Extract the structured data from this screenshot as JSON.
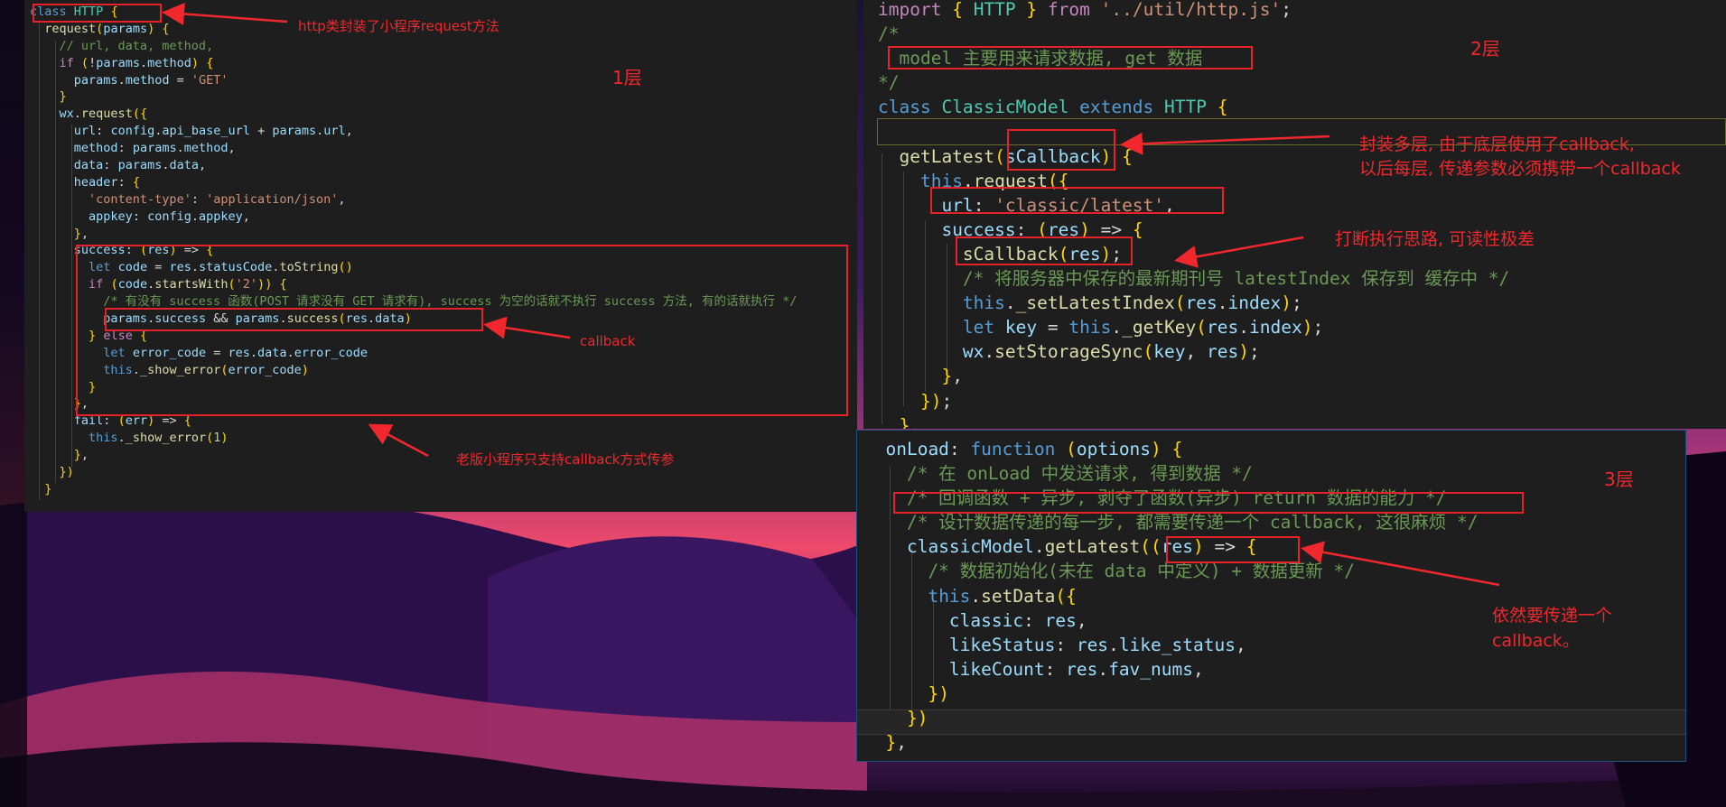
{
  "panel1": {
    "layer_label": "1层",
    "lines": [
      "class HTTP {",
      "  request(params) {",
      "    // url, data, method,",
      "    if (!params.method) {",
      "      params.method = 'GET'",
      "    }",
      "    wx.request({",
      "      url: config.api_base_url + params.url,",
      "      method: params.method,",
      "      data: params.data,",
      "      header: {",
      "        'content-type': 'application/json',",
      "        appkey: config.appkey,",
      "      },",
      "      success: (res) => {",
      "        let code = res.statusCode.toString()",
      "        if (code.startsWith('2')) {",
      "          /* 有没有 success 函数(POST 请求没有 GET 请求有), success 为空的话就不执行 success 方法, 有的话就执行 */",
      "          params.success && params.success(res.data)",
      "        } else {",
      "          let error_code = res.data.error_code",
      "          this._show_error(error_code)",
      "        }",
      "      },",
      "      fail: (err) => {",
      "        this._show_error(1)",
      "      },",
      "    })",
      "  }"
    ],
    "annotations": {
      "class_note": "http类封装了小程序request方法",
      "callback_note": "callback",
      "old_note": "老版小程序只支持callback方式传参"
    }
  },
  "panel2": {
    "layer_label": "2层",
    "lines": [
      "import { HTTP } from '../util/http.js';",
      "/*",
      "  model 主要用来请求数据, get 数据",
      "*/",
      "class ClassicModel extends HTTP {",
      "",
      "  getLatest(sCallback) {",
      "    this.request({",
      "      url: 'classic/latest',",
      "      success: (res) => {",
      "        sCallback(res);",
      "        /* 将服务器中保存的最新期刊号 latestIndex 保存到 缓存中 */",
      "        this._setLatestIndex(res.index);",
      "        let key = this._getKey(res.index);",
      "        wx.setStorageSync(key, res);",
      "      },",
      "    });",
      "  },"
    ],
    "annotations": {
      "wrap_note_1": "封装多层, 由于底层使用了callback,",
      "wrap_note_2": "以后每层, 传递参数必须携带一个callback",
      "break_note": "打断执行思路, 可读性极差"
    }
  },
  "panel3": {
    "layer_label": "3层",
    "lines": [
      "  onLoad: function (options) {",
      "    /* 在 onLoad 中发送请求, 得到数据 */",
      "    /* 回调函数 + 异步, 剥夺了函数(异步) return 数据的能力 */",
      "    /* 设计数据传递的每一步, 都需要传递一个 callback, 这很麻烦 */",
      "    classicModel.getLatest((res) => {",
      "      /* 数据初始化(未在 data 中定义) + 数据更新 */",
      "      this.setData({",
      "        classic: res,",
      "        likeStatus: res.like_status,",
      "        likeCount: res.fav_nums,",
      "      })",
      "    })",
      "  },"
    ],
    "annotations": {
      "still_note_1": "依然要传递一个",
      "still_note_2": "callback。"
    }
  },
  "colors": {
    "annotation": "#f0282d",
    "box": "#e5222a",
    "editor_bg": "#1e1e1e"
  }
}
